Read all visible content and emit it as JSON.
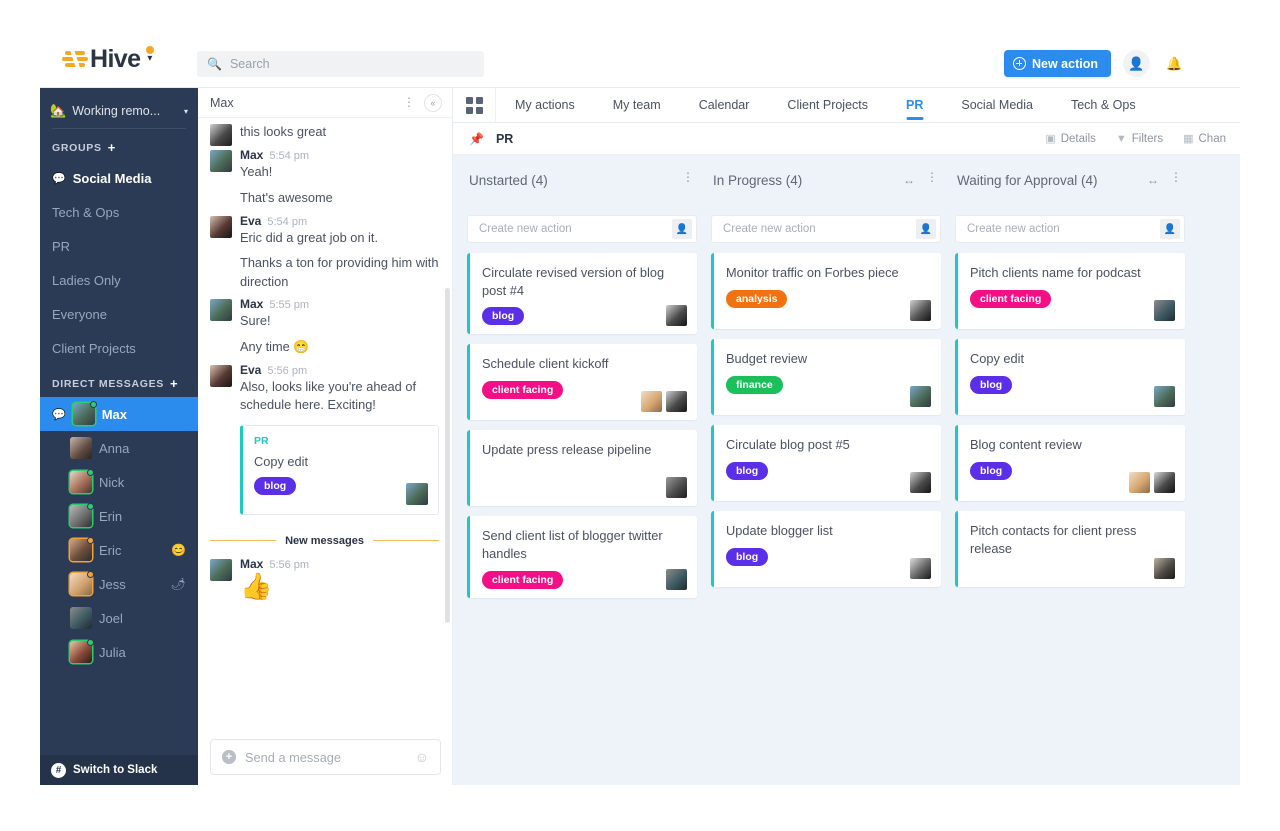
{
  "header": {
    "logo_text": "Hive",
    "logo_caret": "▾",
    "search_placeholder": "Search",
    "search_value": "",
    "search_icon": "search-icon",
    "new_action_label": "New action",
    "add_user_icon": "add-user-icon",
    "bell_icon": "bell-icon"
  },
  "sidebar": {
    "status": {
      "emoji": "🏡",
      "text": "Working remo...",
      "caret": "▾"
    },
    "groups_header": "GROUPS",
    "groups_add": "+",
    "groups": [
      {
        "label": "Social Media",
        "active": true,
        "icon": "chat-bubble-icon"
      },
      {
        "label": "Tech & Ops",
        "active": false
      },
      {
        "label": "PR",
        "active": false
      },
      {
        "label": "Ladies Only",
        "active": false
      },
      {
        "label": "Everyone",
        "active": false
      },
      {
        "label": "Client Projects",
        "active": false
      }
    ],
    "dm_header": "DIRECT MESSAGES",
    "dm_add": "+",
    "dms": [
      {
        "label": "Max",
        "selected": true,
        "presence": "online",
        "emoji": ""
      },
      {
        "label": "Anna",
        "selected": false,
        "presence": "none",
        "emoji": ""
      },
      {
        "label": "Nick",
        "selected": false,
        "presence": "online",
        "emoji": ""
      },
      {
        "label": "Erin",
        "selected": false,
        "presence": "online",
        "emoji": ""
      },
      {
        "label": "Eric",
        "selected": false,
        "presence": "away",
        "emoji": "😊"
      },
      {
        "label": "Jess",
        "selected": false,
        "presence": "away",
        "emoji": "🌶"
      },
      {
        "label": "Joel",
        "selected": false,
        "presence": "none",
        "emoji": ""
      },
      {
        "label": "Julia",
        "selected": false,
        "presence": "online",
        "emoji": ""
      }
    ],
    "switch_to_slack": "Switch to Slack"
  },
  "chat": {
    "title": "Max",
    "kebab_icon": "kebab-menu-icon",
    "collapse_icon": "collapse-left-icon",
    "messages": [
      {
        "author": "",
        "time": "",
        "text": "this looks great",
        "avatar": true
      },
      {
        "author": "Max",
        "time": "5:54 pm",
        "text": "Yeah!",
        "avatar": true
      },
      {
        "author": "",
        "time": "",
        "text": "That's awesome",
        "avatar": false
      },
      {
        "author": "Eva",
        "time": "5:54 pm",
        "text": "Eric did a great job on it.",
        "avatar": true
      },
      {
        "author": "",
        "time": "",
        "text": "Thanks a ton for providing him with direction",
        "avatar": false
      },
      {
        "author": "Max",
        "time": "5:55 pm",
        "text": "Sure!",
        "avatar": true
      },
      {
        "author": "",
        "time": "",
        "text": "Any time 😁",
        "avatar": false
      },
      {
        "author": "Eva",
        "time": "5:56 pm",
        "text": "Also, looks like you're ahead of schedule here. Exciting!",
        "avatar": true
      }
    ],
    "embedded_card": {
      "project": "PR",
      "title": "Copy edit",
      "tag": "blog",
      "tag_color": "#5b2fe8"
    },
    "new_messages_divider": "New messages",
    "last_message": {
      "author": "Max",
      "time": "5:56 pm",
      "emoji": "👍"
    },
    "composer_placeholder": "Send a message",
    "composer_plus_icon": "add-attachment-icon",
    "composer_emoji_icon": "emoji-icon"
  },
  "main": {
    "grid_icon": "apps-grid-icon",
    "tabs": [
      {
        "label": "My actions",
        "active": false
      },
      {
        "label": "My team",
        "active": false
      },
      {
        "label": "Calendar",
        "active": false
      },
      {
        "label": "Client Projects",
        "active": false
      },
      {
        "label": "PR",
        "active": true
      },
      {
        "label": "Social Media",
        "active": false
      },
      {
        "label": "Tech & Ops",
        "active": false
      }
    ],
    "subbar": {
      "pin_icon": "pin-icon",
      "project_name": "PR",
      "actions": [
        {
          "label": "Details",
          "icon": "details-icon"
        },
        {
          "label": "Filters",
          "icon": "filter-icon"
        },
        {
          "label": "Chan",
          "icon": "change-view-icon"
        }
      ]
    }
  },
  "board": {
    "columns": [
      {
        "title": "Unstarted (4)",
        "has_resize": false,
        "create_placeholder": "Create new action",
        "cards": [
          {
            "title": "Circulate revised version of blog post #4",
            "tag": "blog",
            "tag_color": "#5b2fe8",
            "assignees": 1
          },
          {
            "title": "Schedule client kickoff",
            "tag": "client facing",
            "tag_color": "#f50f86",
            "assignees": 2
          },
          {
            "title": "Update press release pipeline",
            "tag": "",
            "tag_color": "",
            "assignees": 1
          },
          {
            "title": "Send client list of blogger twitter handles",
            "tag": "client facing",
            "tag_color": "#f50f86",
            "assignees": 1
          }
        ]
      },
      {
        "title": "In Progress (4)",
        "has_resize": true,
        "create_placeholder": "Create new action",
        "cards": [
          {
            "title": "Monitor traffic on Forbes piece",
            "tag": "analysis",
            "tag_color": "#f27212",
            "assignees": 1
          },
          {
            "title": "Budget review",
            "tag": "finance",
            "tag_color": "#1bc05a",
            "assignees": 1
          },
          {
            "title": "Circulate blog post #5",
            "tag": "blog",
            "tag_color": "#5b2fe8",
            "assignees": 1
          },
          {
            "title": "Update blogger list",
            "tag": "blog",
            "tag_color": "#5b2fe8",
            "assignees": 1
          }
        ]
      },
      {
        "title": "Waiting for Approval (4)",
        "has_resize": true,
        "create_placeholder": "Create new action",
        "cards": [
          {
            "title": "Pitch clients name for podcast",
            "tag": "client facing",
            "tag_color": "#f50f86",
            "assignees": 1
          },
          {
            "title": "Copy edit",
            "tag": "blog",
            "tag_color": "#5b2fe8",
            "assignees": 1
          },
          {
            "title": "Blog content review",
            "tag": "blog",
            "tag_color": "#5b2fe8",
            "assignees": 2
          },
          {
            "title": "Pitch contacts for client press release",
            "tag": "",
            "tag_color": "",
            "assignees": 1
          }
        ]
      }
    ]
  },
  "colors": {
    "brand_orange": "#f5a623",
    "accent_blue": "#2c8ced",
    "sidebar_bg": "#2b3a55",
    "board_bg": "#eef2f9",
    "card_accent": "#1ec9c0"
  }
}
